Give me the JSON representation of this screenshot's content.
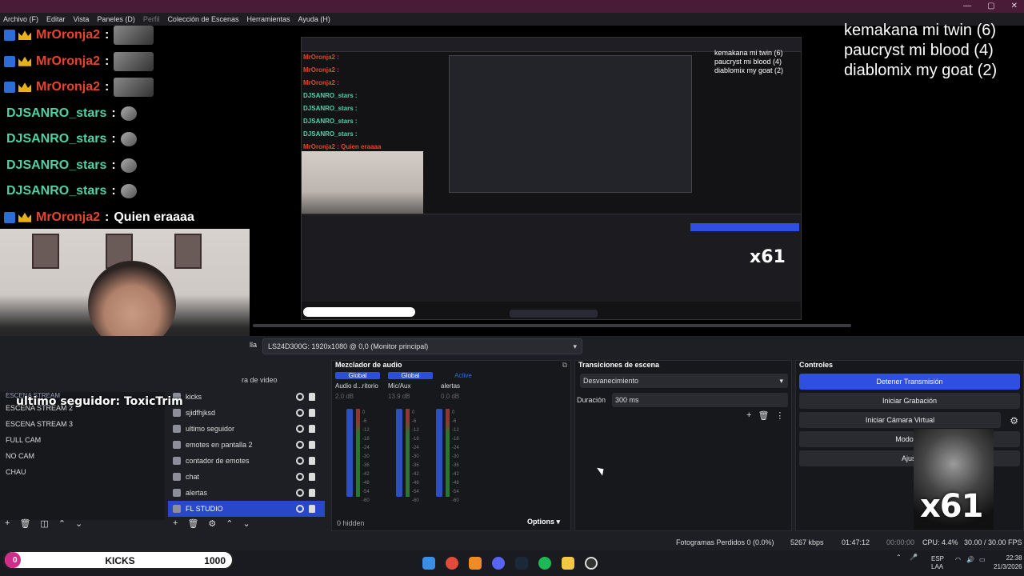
{
  "menu": [
    "Archivo (F)",
    "Editar",
    "Vista",
    "Paneles (D)",
    "Perfil",
    "Colección de Escenas",
    "Herramientas",
    "Ayuda (H)"
  ],
  "chat": [
    {
      "user": "MrOronja2",
      "msg": "",
      "type": "red"
    },
    {
      "user": "MrOronja2",
      "msg": "",
      "type": "red"
    },
    {
      "user": "MrOronja2",
      "msg": "",
      "type": "red"
    },
    {
      "user": "DJSANRO_stars",
      "msg": "",
      "type": "teal"
    },
    {
      "user": "DJSANRO_stars",
      "msg": "",
      "type": "teal"
    },
    {
      "user": "DJSANRO_stars",
      "msg": "",
      "type": "teal"
    },
    {
      "user": "DJSANRO_stars",
      "msg": "",
      "type": "teal"
    },
    {
      "user": "MrOronja2",
      "msg": "Quien eraaaa",
      "type": "red"
    }
  ],
  "chat_sep": ":",
  "counts": [
    "kemakana mi twin (6)",
    "paucryst mi blood (4)",
    "diablomix my goat (2)"
  ],
  "follower": "ultimo seguidor: ToxicTrim",
  "screen_label": "lla",
  "screen_select": "LS24D300G: 1920x1080 @ 0,0 (Monitor principal)",
  "scenes": [
    "ESCENA STREAM",
    "ESCENA STREAM 2",
    "ESCENA STREAM 3",
    "FULL CAM",
    "NO CAM",
    "CHAU"
  ],
  "sources_fragment": "ra de video",
  "sources": [
    "kicks",
    "sjidfhjksd",
    "ultimo seguidor",
    "emotes en pantalla 2",
    "contador de emotes",
    "chat",
    "alertas",
    "FL STUDIO"
  ],
  "mixer": {
    "title": "Mezclador de audio",
    "channels": [
      {
        "tab": "Global",
        "name": "Audio d...ritorio",
        "db": "2.0 dB"
      },
      {
        "tab": "Global",
        "name": "Mic/Aux",
        "db": "13.9 dB"
      },
      {
        "tab": "Active",
        "name": "alertas",
        "db": "0.0 dB"
      }
    ],
    "scale": [
      "0",
      "-6",
      "-12",
      "-18",
      "-24",
      "-30",
      "-36",
      "-42",
      "-48",
      "-54",
      "-60"
    ],
    "hidden": "0 hidden",
    "options": "Options"
  },
  "transitions": {
    "title": "Transiciones de escena",
    "select": "Desvanecimiento",
    "duration_label": "Duración",
    "duration": "300 ms"
  },
  "controls": {
    "title": "Controles",
    "buttons": [
      "Detener Transmisión",
      "Iniciar Grabación",
      "Iniciar Cámara Virtual",
      "Modo Es",
      "Ajust"
    ]
  },
  "x61": "x61",
  "status": {
    "dropped": "Fotogramas Perdidos 0 (0.0%)",
    "kbps": "5267 kbps",
    "live": "01:47:12",
    "rec": "00:00:00",
    "cpu": "CPU: 4.4%",
    "fps": "30.00 / 30.00 FPS"
  },
  "kicks": {
    "current": "0",
    "label": "KICKS",
    "goal": "1000",
    "progress_fraction": 0.0
  },
  "tray": {
    "lang1": "ESP",
    "lang2": "LAA",
    "time": "22:38",
    "date": "21/3/2026"
  },
  "preview": {
    "counts": [
      "kemakana mi twin (6)",
      "paucryst mi blood (4)",
      "diablomix my goat (2)"
    ],
    "chat": [
      "MrOronja2 :",
      "MrOronja2 :",
      "MrOronja2 :",
      "DJSANRO_stars :",
      "DJSANRO_stars :",
      "DJSANRO_stars :",
      "DJSANRO_stars :",
      "MrOronja2 : Quien eraaaa"
    ],
    "follower": "ultimo seguidor: ToxicTrim",
    "x61": "x61"
  },
  "colors": {
    "accent": "#2e4fe0",
    "title_bar": "#4a1b36",
    "chat_red": "#e8442c",
    "chat_teal": "#4fd1a5"
  }
}
